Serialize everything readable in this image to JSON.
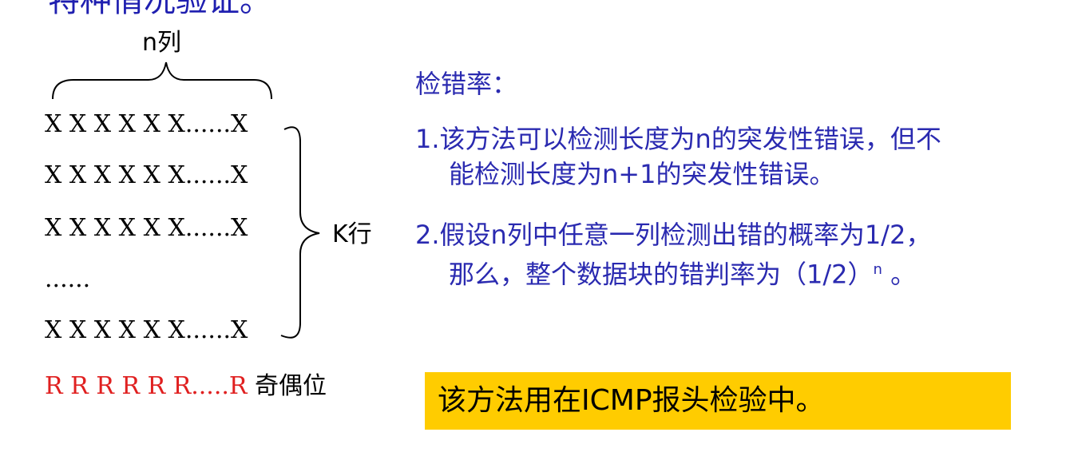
{
  "top_cut_text": "特种情况验证。",
  "diagram": {
    "column_label": "n列",
    "rows": [
      "X X X X X X......X",
      "X X X X X X......X",
      "X X X X X X......X",
      "......",
      "X X X X X X......X"
    ],
    "row_label": "K行",
    "parity_row": "R R R R R R.....R",
    "parity_label": "奇偶位",
    "colors": {
      "text": "#000000",
      "parity": "#e02020"
    }
  },
  "notes": {
    "title": "检错率：",
    "item1_line1": "1.该方法可以检测长度为n的突发性错误，但不",
    "item1_line2": "能检测长度为n+1的突发性错误。",
    "item2_line1": "2.假设n列中任意一列检测出错的概率为1/2，",
    "item2_line2_a": "那么，整个数据块的错判率为（1/2）",
    "item2_line2_sup": "n",
    "item2_line2_b": " 。",
    "color": "#2a2ab0"
  },
  "highlight": {
    "text": "该方法用在ICMP报头检验中。",
    "bg": "#ffcc00"
  }
}
